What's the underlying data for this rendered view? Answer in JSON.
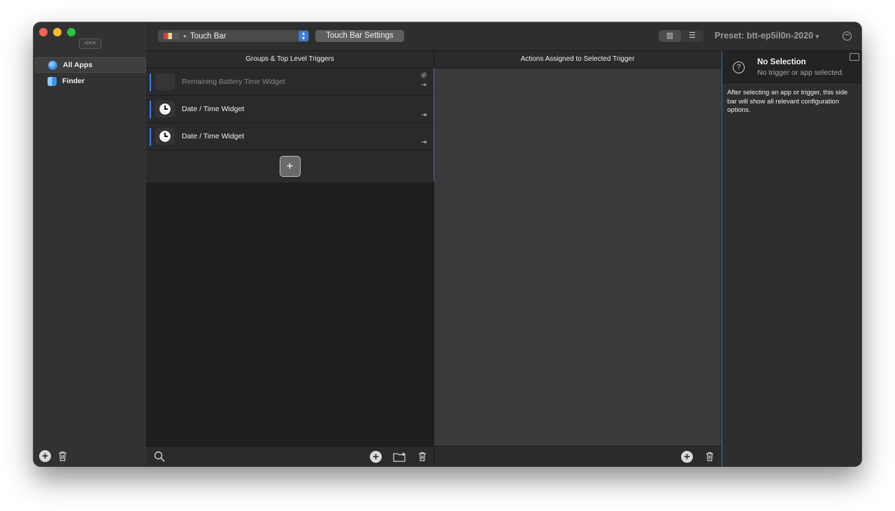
{
  "sidebar": {
    "collapse_label": "<<<",
    "apps": [
      {
        "label": "All Apps",
        "selected": true,
        "icon": "globe-icon"
      },
      {
        "label": "Finder",
        "selected": false,
        "icon": "finder-icon"
      }
    ]
  },
  "toolbar": {
    "context_select": "Touch Bar",
    "settings_button": "Touch Bar Settings",
    "preset_label": "Preset: btt-ep5il0n-2020",
    "preset_caret": "▾"
  },
  "groups_panel": {
    "header": "Groups & Top Level Triggers",
    "triggers": [
      {
        "label": "Remaining Battery Time Widget",
        "hidden": true
      },
      {
        "label": "Date / Time Widget",
        "hidden": false
      },
      {
        "label": "Date / Time Widget",
        "hidden": false
      }
    ],
    "add_label": "+"
  },
  "actions_panel": {
    "header": "Actions Assigned to Selected Trigger"
  },
  "inspector": {
    "title": "No Selection",
    "subtitle": "No trigger or app selected.",
    "body": "After selecting an app or trigger, this side bar will show all relevant configuration options."
  },
  "colors": {
    "accent": "#3d7ee0",
    "window_bg": "#2a2a2c"
  }
}
